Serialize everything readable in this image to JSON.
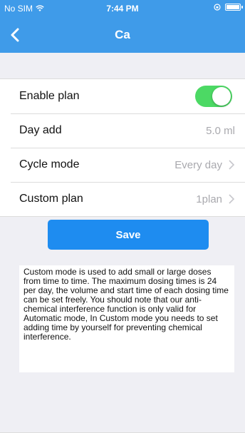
{
  "status_bar": {
    "carrier": "No SIM",
    "time": "7:44 PM"
  },
  "nav": {
    "title": "Ca"
  },
  "settings": {
    "enable_plan_label": "Enable plan",
    "enable_plan_on": true,
    "day_add_label": "Day add",
    "day_add_value": "5.0 ml",
    "cycle_mode_label": "Cycle mode",
    "cycle_mode_value": "Every day",
    "custom_plan_label": "Custom plan",
    "custom_plan_value": "1plan"
  },
  "save_label": "Save",
  "note_text": "Custom mode is used to add small or large doses from time to time. The maximum dosing times is 24 per day, the volume and start time of each dosing time can be set freely. You should note that our anti-chemical interference function is only valid for Automatic mode,  In Custom mode you needs to set adding time by yourself for preventing chemical interference.",
  "colors": {
    "nav_background": "#3f9be9",
    "toggle_on": "#4cd964",
    "save_button": "#1e8cf0"
  },
  "icons": {
    "back": "chevron-left-icon",
    "wifi": "wifi-icon",
    "battery": "battery-icon",
    "lock": "orientation-lock-icon",
    "disclosure": "chevron-right-icon"
  }
}
